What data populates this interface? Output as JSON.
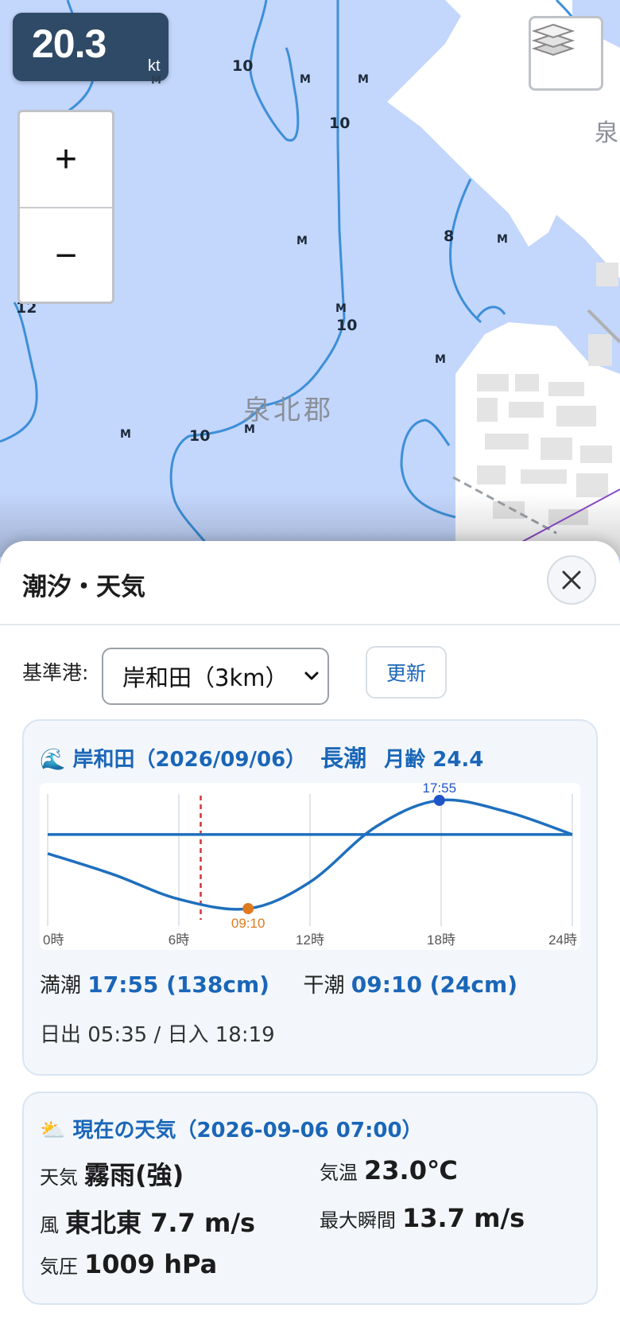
{
  "map": {
    "speed": {
      "value": "20.3",
      "unit": "kt",
      "sub": "M"
    },
    "zoom": {
      "in_label": "+",
      "out_label": "−"
    },
    "depth_labels": [
      "10",
      "10",
      "8",
      "10",
      "12",
      "10"
    ],
    "m_labels": [
      "M",
      "M",
      "M",
      "M",
      "M",
      "M",
      "M",
      "M"
    ],
    "place_name": "泉北郡",
    "edge_label": "泉"
  },
  "panel": {
    "title": "潮汐・天気",
    "port_label": "基準港:",
    "port_selected": "岸和田（3km）",
    "refresh_label": "更新"
  },
  "tide": {
    "icon": "🌊",
    "heading": "岸和田（2026/09/06）",
    "tide_type": "長潮",
    "moon_age": "月齢 24.4",
    "high_label": "満潮",
    "high_value": "17:55 (138cm)",
    "low_label": "干潮",
    "low_value": "09:10 (24cm)",
    "sun": "日出 05:35 / 日入 18:19"
  },
  "chart_data": {
    "type": "line",
    "x_ticks": [
      "0時",
      "6時",
      "12時",
      "18時",
      "24時"
    ],
    "xlim": [
      0,
      24
    ],
    "series": [
      {
        "x": [
          0,
          3,
          6,
          9.17,
          12,
          15,
          17.92,
          21,
          24
        ],
        "y": [
          82,
          60,
          34,
          24,
          52,
          110,
          138,
          126,
          102
        ]
      }
    ],
    "level_line_y": 102,
    "current_time": 7.0,
    "high": {
      "time": 17.92,
      "label": "17:55",
      "color": "#1f55c9"
    },
    "low": {
      "time": 9.17,
      "label": "09:10",
      "color": "#e07a1f"
    },
    "ylim": [
      14,
      148
    ],
    "line_color": "#1f6fbd"
  },
  "weather": {
    "icon": "⛅",
    "heading": "現在の天気（2026-09-06 07:00）",
    "cond_label": "天気",
    "cond_value": "霧雨(強)",
    "temp_label": "気温",
    "temp_value": "23.0℃",
    "wind_label": "風",
    "wind_value": "東北東 7.7 m/s",
    "gust_label": "最大瞬間",
    "gust_value": "13.7 m/s",
    "pressure_label": "気圧",
    "pressure_value": "1009 hPa"
  }
}
